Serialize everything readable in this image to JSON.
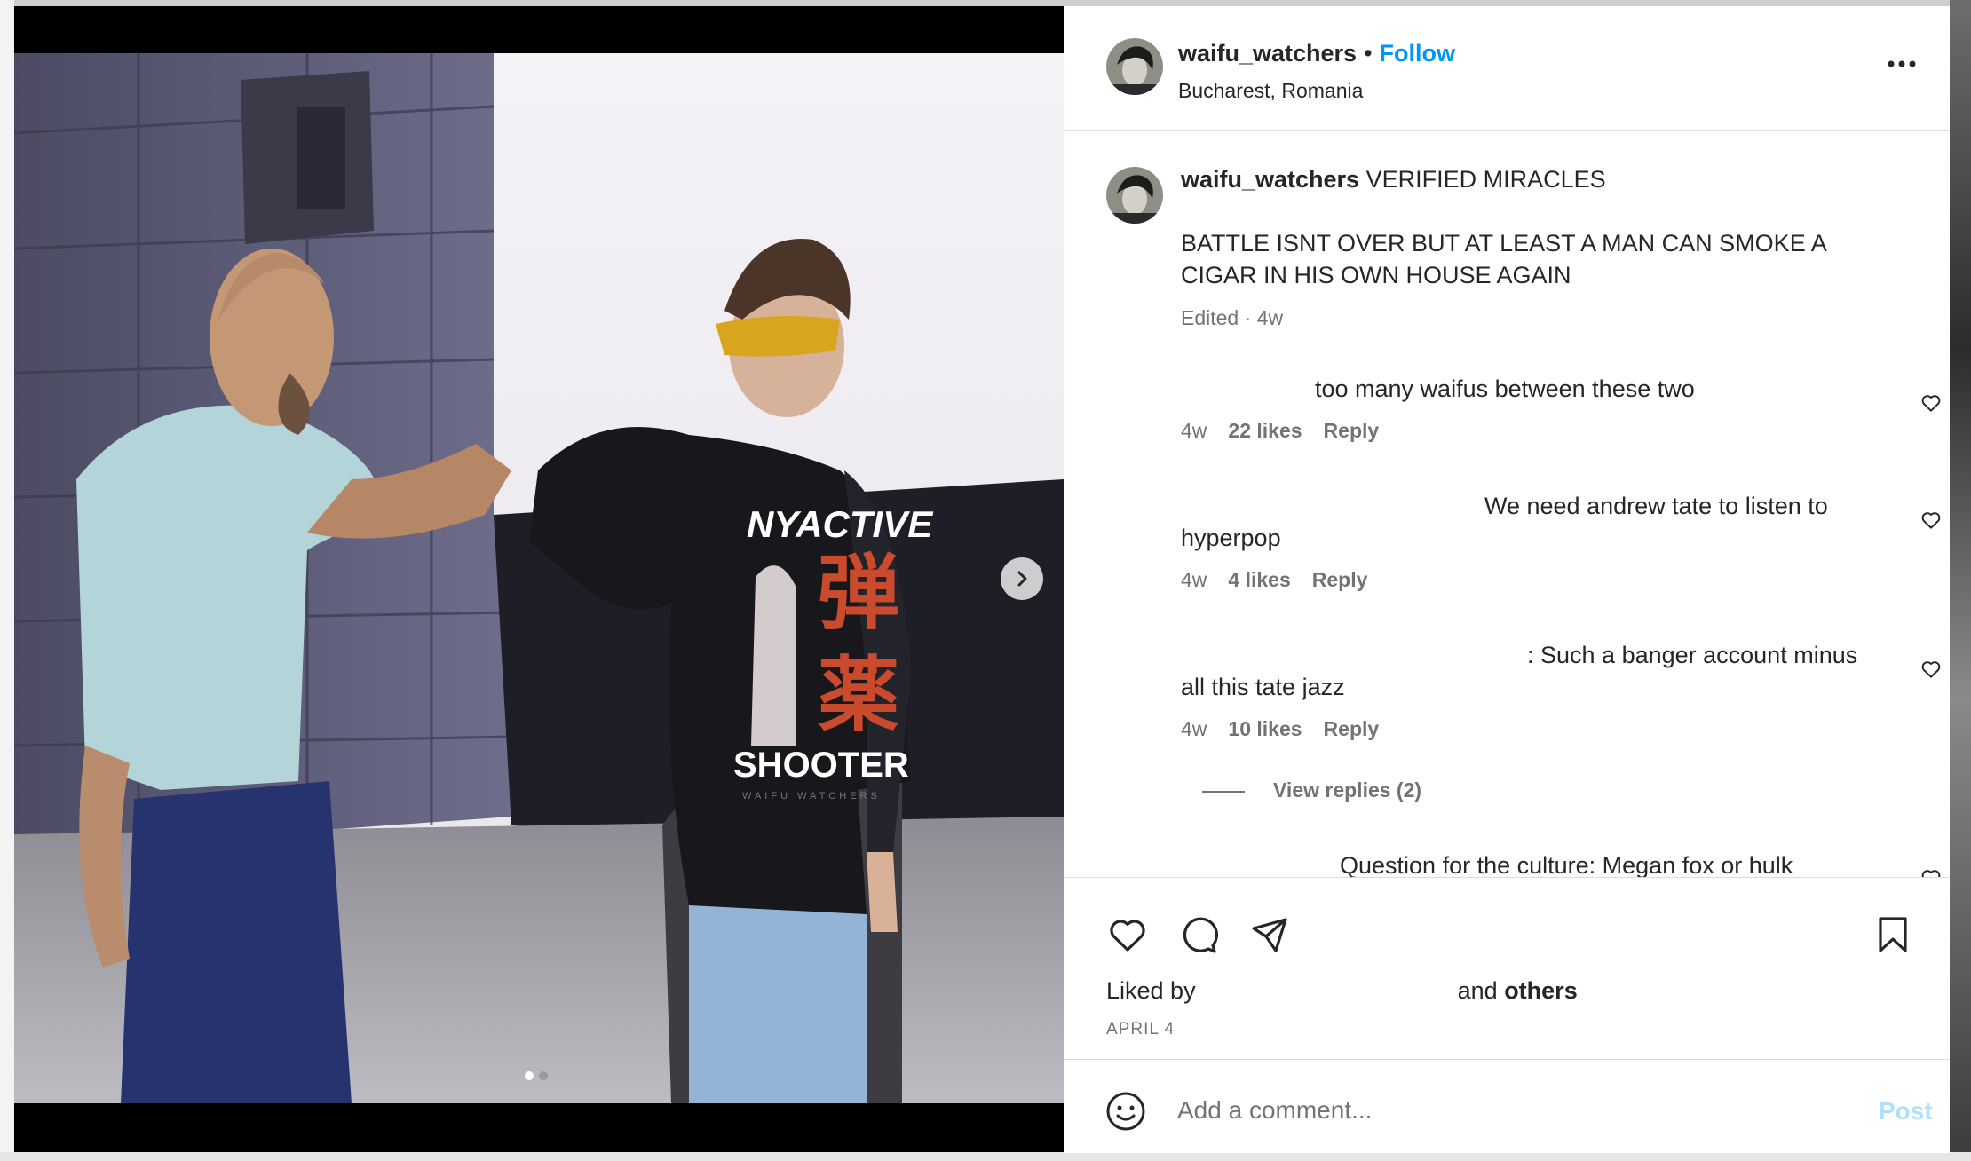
{
  "post": {
    "username": "waifu_watchers",
    "follow_label": "Follow",
    "separator": "•",
    "location": "Bucharest, Romania"
  },
  "caption": {
    "username": "waifu_watchers",
    "title": "VERIFIED MIRACLES",
    "line1": "BATTLE ISNT OVER BUT AT LEAST A MAN CAN SMOKE A",
    "line2": "CIGAR IN HIS OWN HOUSE AGAIN",
    "meta": "Edited · 4w"
  },
  "comments": [
    {
      "text": "too many waifus between these two",
      "time": "4w",
      "likes": "22 likes",
      "reply": "Reply"
    },
    {
      "text_line1": "We need andrew tate to listen to",
      "text_line2": "hyperpop",
      "time": "4w",
      "likes": "4 likes",
      "reply": "Reply"
    },
    {
      "text_line1": ": Such a banger account minus",
      "text_line2": "all this tate jazz",
      "time": "4w",
      "likes": "10 likes",
      "reply": "Reply",
      "view_replies": "View replies (2)"
    },
    {
      "text": "Question for the culture: Megan fox or hulk"
    }
  ],
  "likes_summary": {
    "prefix": "Liked by",
    "middle": "and",
    "suffix": "others",
    "date": "APRIL 4"
  },
  "composer": {
    "placeholder": "Add a comment...",
    "post_label": "Post"
  },
  "shirt": {
    "top": "NYACTIVE",
    "bottom": "SHOOTER",
    "small": "WAIFU WATCHERS",
    "kanji1": "弾",
    "kanji2": "薬"
  },
  "colors": {
    "accent": "#0095f6",
    "post_disabled": "#b2dffc",
    "text": "#262626",
    "muted": "#737373"
  },
  "icons": [
    "chevron-right-icon",
    "more-icon",
    "heart-icon",
    "comment-icon",
    "share-icon",
    "bookmark-icon",
    "emoji-icon"
  ],
  "carousel": {
    "count": 2,
    "active": 1
  }
}
